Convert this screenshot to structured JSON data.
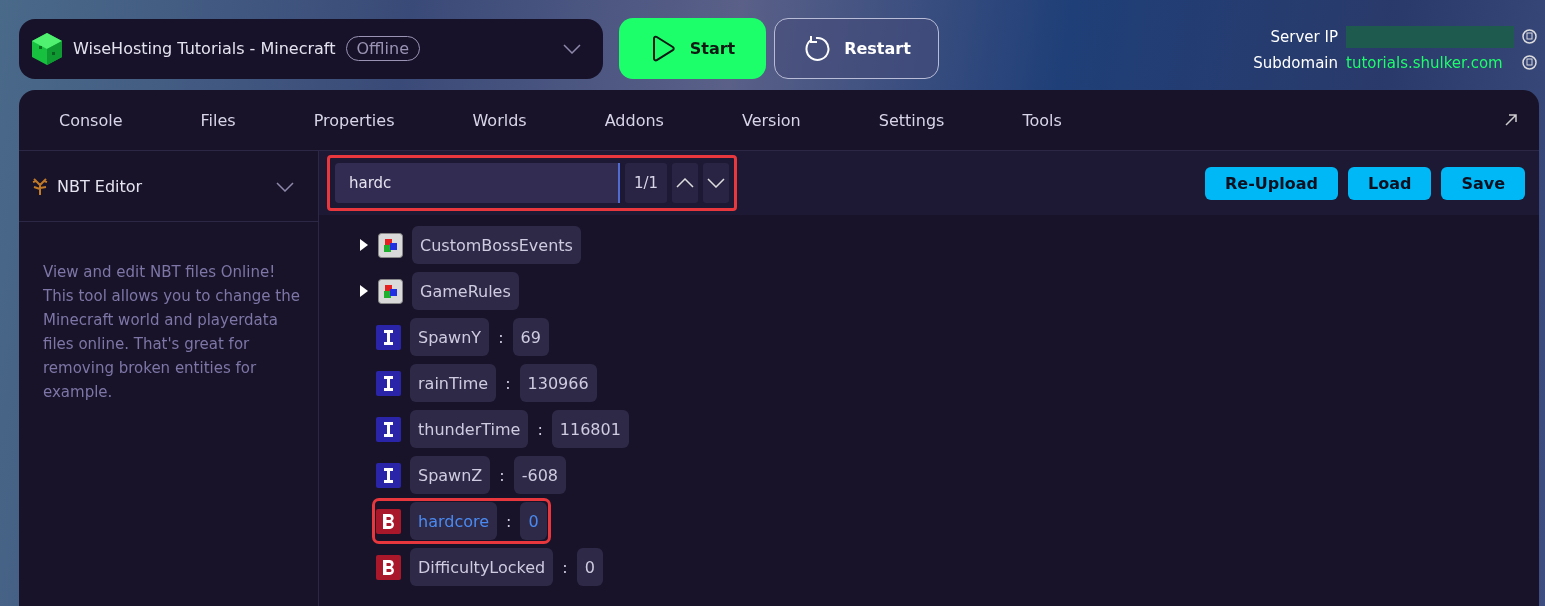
{
  "server": {
    "name": "WiseHosting Tutorials - Minecraft",
    "status": "Offline"
  },
  "actions": [
    {
      "kind": "start",
      "label": "Start"
    },
    {
      "kind": "restart",
      "label": "Restart"
    }
  ],
  "connection": {
    "server_ip_label": "Server IP",
    "subdomain_label": "Subdomain",
    "subdomain": "tutorials.shulker.com"
  },
  "tabs": [
    "Console",
    "Files",
    "Properties",
    "Worlds",
    "Addons",
    "Version",
    "Settings",
    "Tools"
  ],
  "sidebar": {
    "tool": "NBT Editor",
    "description": "View and edit NBT files Online! This tool allows you to change the Minecraft world and playerdata files online. That's great for removing broken entities for example."
  },
  "search": {
    "value": "hardc",
    "counter": "1/1"
  },
  "file_buttons": [
    "Re-Upload",
    "Load",
    "Save"
  ],
  "tree": [
    {
      "kind": "compound",
      "name": "CustomBossEvents",
      "match": false
    },
    {
      "kind": "compound",
      "name": "GameRules",
      "match": false
    },
    {
      "kind": "int",
      "name": "SpawnY",
      "value": "69",
      "separator": ":",
      "match": false
    },
    {
      "kind": "int",
      "name": "rainTime",
      "value": "130966",
      "separator": ":",
      "match": false
    },
    {
      "kind": "int",
      "name": "thunderTime",
      "value": "116801",
      "separator": ":",
      "match": false
    },
    {
      "kind": "int",
      "name": "SpawnZ",
      "value": "-608",
      "separator": ":",
      "match": false
    },
    {
      "kind": "byte",
      "name": "hardcore",
      "value": "0",
      "separator": ":",
      "match": true
    },
    {
      "kind": "byte",
      "name": "DifficultyLocked",
      "value": "0",
      "separator": ":",
      "match": false
    }
  ]
}
